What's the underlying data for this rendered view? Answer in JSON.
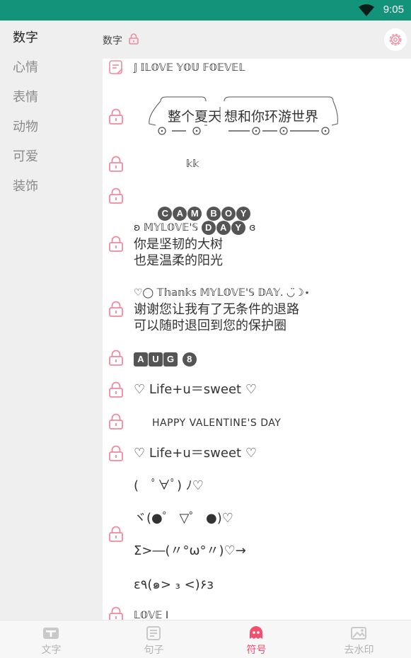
{
  "status_bar": {
    "time": "9:05",
    "wifi_icon": "wifi-icon"
  },
  "sidebar": {
    "items": [
      {
        "label": "数字",
        "active": true
      },
      {
        "label": "心情"
      },
      {
        "label": "表情"
      },
      {
        "label": "动物"
      },
      {
        "label": "可爱"
      },
      {
        "label": "装饰"
      }
    ]
  },
  "header": {
    "title": "数字",
    "title_icon": "lock-icon",
    "settings_icon": "gear-icon"
  },
  "list": {
    "row0": "𝕁 𝕀𝕃𝕆𝕍𝔼 𝕐𝕆𝕌 𝔽𝕆𝔼𝕍𝔼𝕃",
    "row1": {
      "left": "整个夏天",
      "right": "想和你环游世界"
    },
    "row2": "𝕜𝕜",
    "row3": [
      "C",
      "A",
      "M",
      "B",
      "O",
      "Y"
    ],
    "row4": {
      "line1_prefix": "ʚ 𝕄𝕐𝕃𝕆𝕍𝔼'𝕊",
      "line1_pills": [
        "D",
        "A",
        "Y"
      ],
      "line1_suffix": "ɞ",
      "line2": "你是坚韧的大树",
      "line3": "也是温柔的阳光"
    },
    "row5": {
      "line1": "♡◯ 𝕋𝕙𝕒𝕟𝕜𝕤 𝕄𝕐𝕃𝕆𝕍𝔼'𝕊 𝔻𝔸𝕐. ◡̈☽⋆",
      "line2": "谢谢您让我有了无条件的退路",
      "line3": "可以随时退回到您的保护圈"
    },
    "row6": {
      "squares": [
        "A",
        "U",
        "G"
      ],
      "pill": "8"
    },
    "row7": "♡ Life+u＝sweet ♡",
    "row8": "HAPPY VALENTINE'S DAY",
    "row9": "♡ Life+u＝sweet ♡",
    "row10": [
      "(　ﾟ∀ﾟ) ﾉ♡",
      "ヾ(●゜ ▽゜ ●)♡",
      "Σ>―(〃°ω°〃)♡→",
      "ε٩(๑> ₃ <)۶з"
    ],
    "row11": "𝕃𝕆𝕍𝔼 I"
  },
  "tabbar": {
    "tabs": [
      {
        "label": "文字",
        "icon": "text-icon"
      },
      {
        "label": "句子",
        "icon": "sentence-icon"
      },
      {
        "label": "符号",
        "icon": "symbol-icon",
        "active": true
      },
      {
        "label": "去水印",
        "icon": "watermark-icon"
      }
    ]
  },
  "colors": {
    "status_bar": "#12937a",
    "accent": "#f2506e",
    "lock": "#f08a9c"
  }
}
